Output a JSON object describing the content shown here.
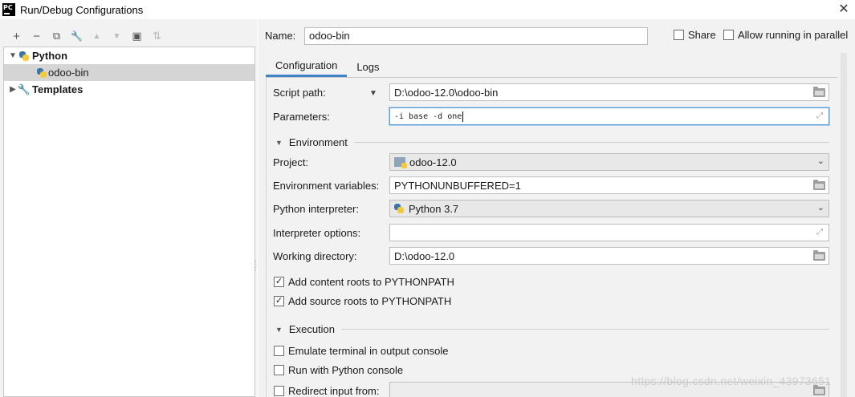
{
  "window": {
    "title": "Run/Debug Configurations",
    "app_logo": "PC"
  },
  "toolbar": {
    "buttons": [
      {
        "icon": "plus-icon",
        "glyph": "+"
      },
      {
        "icon": "minus-icon",
        "glyph": "−"
      },
      {
        "icon": "copy-icon",
        "glyph": "⧉"
      },
      {
        "icon": "wrench-icon",
        "glyph": "🔧"
      },
      {
        "icon": "arrow-up-icon",
        "glyph": "▲"
      },
      {
        "icon": "arrow-down-icon",
        "glyph": "▼"
      },
      {
        "icon": "folder-add-icon",
        "glyph": "▣"
      },
      {
        "icon": "sort-icon",
        "glyph": "⇅"
      }
    ]
  },
  "tree": {
    "python_label": "Python",
    "odoo_label": "odoo-bin",
    "templates_label": "Templates"
  },
  "header": {
    "name_label": "Name:",
    "name_value": "odoo-bin",
    "share_label": "Share",
    "parallel_label": "Allow running in parallel"
  },
  "tabs": {
    "configuration": "Configuration",
    "logs": "Logs"
  },
  "form": {
    "script_path_label": "Script path:",
    "script_path_value": "D:\\odoo-12.0\\odoo-bin",
    "parameters_label": "Parameters:",
    "parameters_value": "-i base -d one",
    "environment_section": "Environment",
    "project_label": "Project:",
    "project_value": "odoo-12.0",
    "env_vars_label": "Environment variables:",
    "env_vars_value": "PYTHONUNBUFFERED=1",
    "interpreter_label": "Python interpreter:",
    "interpreter_value": "Python 3.7",
    "interp_options_label": "Interpreter options:",
    "interp_options_value": "",
    "working_dir_label": "Working directory:",
    "working_dir_value": "D:\\odoo-12.0",
    "content_roots_label": "Add content roots to PYTHONPATH",
    "source_roots_label": "Add source roots to PYTHONPATH",
    "execution_section": "Execution",
    "emulate_terminal_label": "Emulate terminal in output console",
    "python_console_label": "Run with Python console",
    "redirect_input_label": "Redirect input from:"
  },
  "watermark": "https://blog.csdn.net/weixin_43973651"
}
